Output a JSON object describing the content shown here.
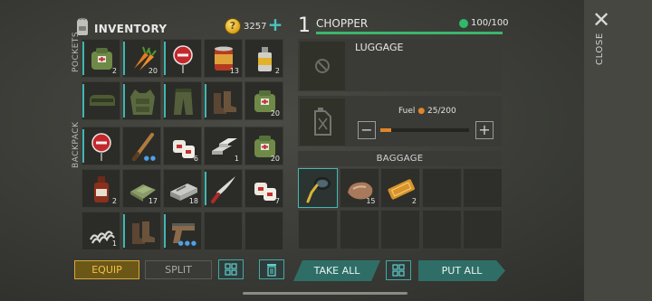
{
  "inventory": {
    "title": "INVENTORY",
    "coins": "3257",
    "add_label": "+",
    "pockets_label": "POCKETS",
    "backpack_label": "BACKPACK"
  },
  "pockets": [
    {
      "item": "bag-icon",
      "count": "2",
      "bar": true
    },
    {
      "item": "carrots-icon",
      "count": "20",
      "bar": true
    },
    {
      "item": "stop-sign-icon",
      "count": "",
      "bar": true
    },
    {
      "item": "canned-food-icon",
      "count": "13",
      "bar": false
    },
    {
      "item": "spray-can-icon",
      "count": "2",
      "bar": false
    },
    {
      "item": "gloves-icon",
      "count": "",
      "bar": true
    },
    {
      "item": "armor-vest-icon",
      "count": "",
      "bar": true
    },
    {
      "item": "pants-icon",
      "count": "",
      "bar": true
    },
    {
      "item": "boots-icon",
      "count": "",
      "bar": true
    },
    {
      "item": "bag-icon",
      "count": "20",
      "bar": false
    }
  ],
  "backpack": [
    {
      "item": "stop-sign-icon",
      "count": "",
      "bar": true
    },
    {
      "item": "baseball-bat-icon",
      "count": "",
      "bar": false,
      "dots": "●●"
    },
    {
      "item": "bandage-icon",
      "count": "6",
      "bar": false
    },
    {
      "item": "metal-bars-icon",
      "count": "1",
      "bar": false
    },
    {
      "item": "bag-icon",
      "count": "20",
      "bar": false
    },
    {
      "item": "bottle-icon",
      "count": "2",
      "bar": false
    },
    {
      "item": "cloth-icon",
      "count": "17",
      "bar": false
    },
    {
      "item": "safe-icon",
      "count": "18",
      "bar": false
    },
    {
      "item": "machete-icon",
      "count": "",
      "bar": true
    },
    {
      "item": "bandage-icon",
      "count": "7",
      "bar": false
    },
    {
      "item": "spring-icon",
      "count": "1",
      "bar": false
    },
    {
      "item": "boots-icon",
      "count": "",
      "bar": true
    },
    {
      "item": "pistol-icon",
      "count": "",
      "bar": true,
      "dots": "●●●"
    },
    {
      "item": "empty",
      "count": "",
      "bar": false
    },
    {
      "item": "empty",
      "count": "",
      "bar": false
    }
  ],
  "chopper": {
    "slot_number": "1",
    "title": "CHOPPER",
    "hp": "100/100",
    "hp_color": "#3cb56d",
    "luggage_label": "LUGGAGE",
    "fuel_label": "Fuel",
    "fuel_value": "25/200",
    "fuel_fraction": 0.125,
    "fuel_color": "#e0862a",
    "baggage_label": "BAGGAGE",
    "baggage": [
      {
        "item": "shovel-icon",
        "count": "",
        "selected": true
      },
      {
        "item": "rock-icon",
        "count": "15",
        "selected": false
      },
      {
        "item": "ticket-icon",
        "count": "2",
        "selected": false
      },
      {
        "item": "empty",
        "count": "",
        "selected": false
      },
      {
        "item": "empty",
        "count": "",
        "selected": false
      },
      {
        "item": "empty",
        "count": "",
        "selected": false
      },
      {
        "item": "empty",
        "count": "",
        "selected": false
      },
      {
        "item": "empty",
        "count": "",
        "selected": false
      },
      {
        "item": "empty",
        "count": "",
        "selected": false
      },
      {
        "item": "empty",
        "count": "",
        "selected": false
      }
    ]
  },
  "close": {
    "label": "CLOSE"
  },
  "actions": {
    "equip": "EQUIP",
    "split": "SPLIT",
    "take_all": "TAKE ALL",
    "put_all": "PUT ALL"
  },
  "colors": {
    "accent": "#47b7b2",
    "equip": "#f3c24a"
  }
}
